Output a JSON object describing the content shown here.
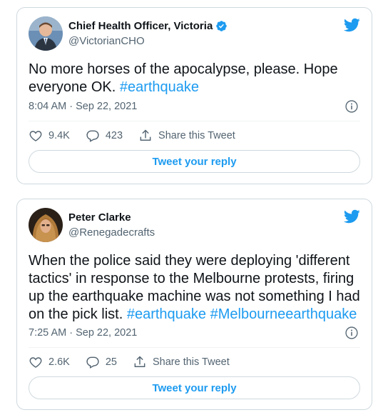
{
  "tweets": [
    {
      "display_name": "Chief Health Officer, Victoria",
      "verified": true,
      "handle": "@VictorianCHO",
      "text_plain": "No more horses of the apocalypse, please. Hope everyone OK. ",
      "hashtags": [
        "#earthquake"
      ],
      "timestamp": "8:04 AM · Sep 22, 2021",
      "likes": "9.4K",
      "replies": "423",
      "share_label": "Share this Tweet",
      "reply_label": "Tweet your reply"
    },
    {
      "display_name": "Peter Clarke",
      "verified": false,
      "handle": "@Renegadecrafts",
      "text_plain": "When the police said they were deploying 'different tactics' in response to the Melbourne protests, firing up the earthquake machine was not something I had on the pick list. ",
      "hashtags": [
        "#earthquake",
        "#Melbourneearthquake"
      ],
      "timestamp": "7:25 AM · Sep 22, 2021",
      "likes": "2.6K",
      "replies": "25",
      "share_label": "Share this Tweet",
      "reply_label": "Tweet your reply"
    }
  ],
  "colors": {
    "accent": "#1d9bf0",
    "text_primary": "#0f1419",
    "text_secondary": "#536471",
    "border": "#cfd9de"
  },
  "icons": [
    "twitter-bird-icon",
    "verified-badge-icon",
    "info-icon",
    "heart-icon",
    "reply-icon",
    "share-icon"
  ]
}
